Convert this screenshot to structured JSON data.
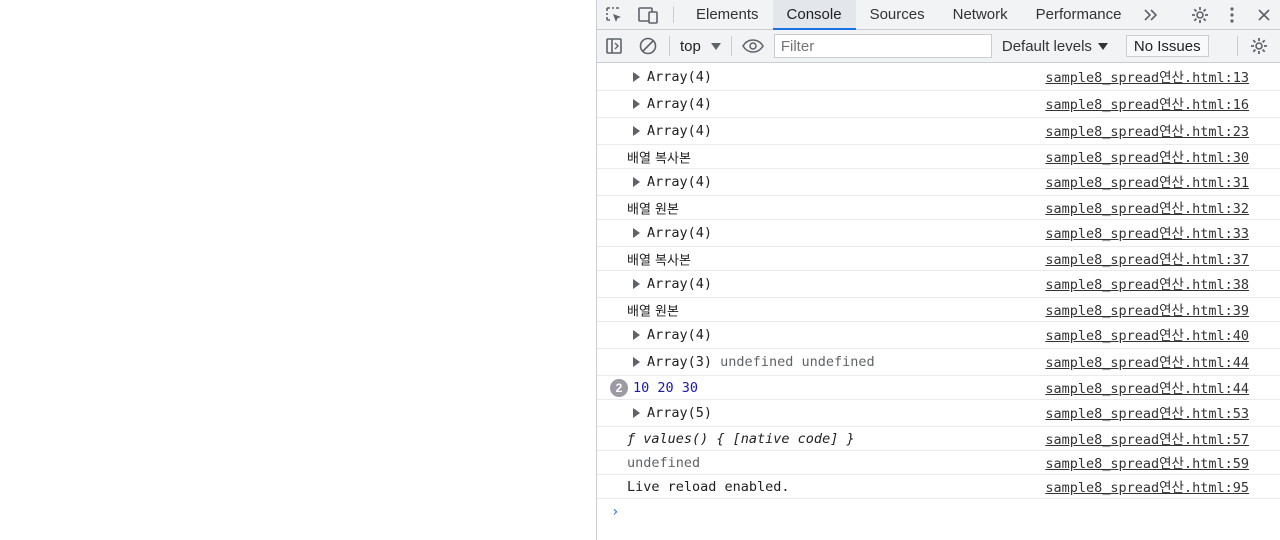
{
  "tabs": [
    {
      "label": "Elements"
    },
    {
      "label": "Console"
    },
    {
      "label": "Sources"
    },
    {
      "label": "Network"
    },
    {
      "label": "Performance"
    }
  ],
  "toolbar": {
    "context": "top",
    "filter_placeholder": "Filter",
    "levels": "Default levels",
    "issues": "No Issues"
  },
  "messages": [
    {
      "kind": "expand",
      "text": "Array(4)",
      "source": "sample8_spread연산.html:13"
    },
    {
      "kind": "expand",
      "text": "Array(4)",
      "source": "sample8_spread연산.html:16"
    },
    {
      "kind": "expand",
      "text": "Array(4)",
      "source": "sample8_spread연산.html:23"
    },
    {
      "kind": "plain",
      "text": "배열 복사본",
      "source": "sample8_spread연산.html:30"
    },
    {
      "kind": "expand",
      "text": "Array(4)",
      "source": "sample8_spread연산.html:31"
    },
    {
      "kind": "plain",
      "text": "배열 원본",
      "source": "sample8_spread연산.html:32"
    },
    {
      "kind": "expand",
      "text": "Array(4)",
      "source": "sample8_spread연산.html:33"
    },
    {
      "kind": "plain",
      "text": "배열 복사본",
      "source": "sample8_spread연산.html:37"
    },
    {
      "kind": "expand",
      "text": "Array(4)",
      "source": "sample8_spread연산.html:38"
    },
    {
      "kind": "plain",
      "text": "배열 원본",
      "source": "sample8_spread연산.html:39"
    },
    {
      "kind": "expand",
      "text": "Array(4)",
      "source": "sample8_spread연산.html:40"
    },
    {
      "kind": "expand",
      "text": "Array(3)",
      "extra": "undefined undefined",
      "source": "sample8_spread연산.html:44"
    },
    {
      "kind": "repeat",
      "count": "2",
      "text": "10 20 30",
      "source": "sample8_spread연산.html:44"
    },
    {
      "kind": "expand",
      "text": "Array(5)",
      "source": "sample8_spread연산.html:53"
    },
    {
      "kind": "func",
      "text": "ƒ values() { [native code] }",
      "source": "sample8_spread연산.html:57"
    },
    {
      "kind": "gray",
      "text": "undefined",
      "source": "sample8_spread연산.html:59"
    },
    {
      "kind": "plain-mono",
      "text": "Live reload enabled.",
      "source": "sample8_spread연산.html:95"
    }
  ],
  "prompt_symbol": "›"
}
